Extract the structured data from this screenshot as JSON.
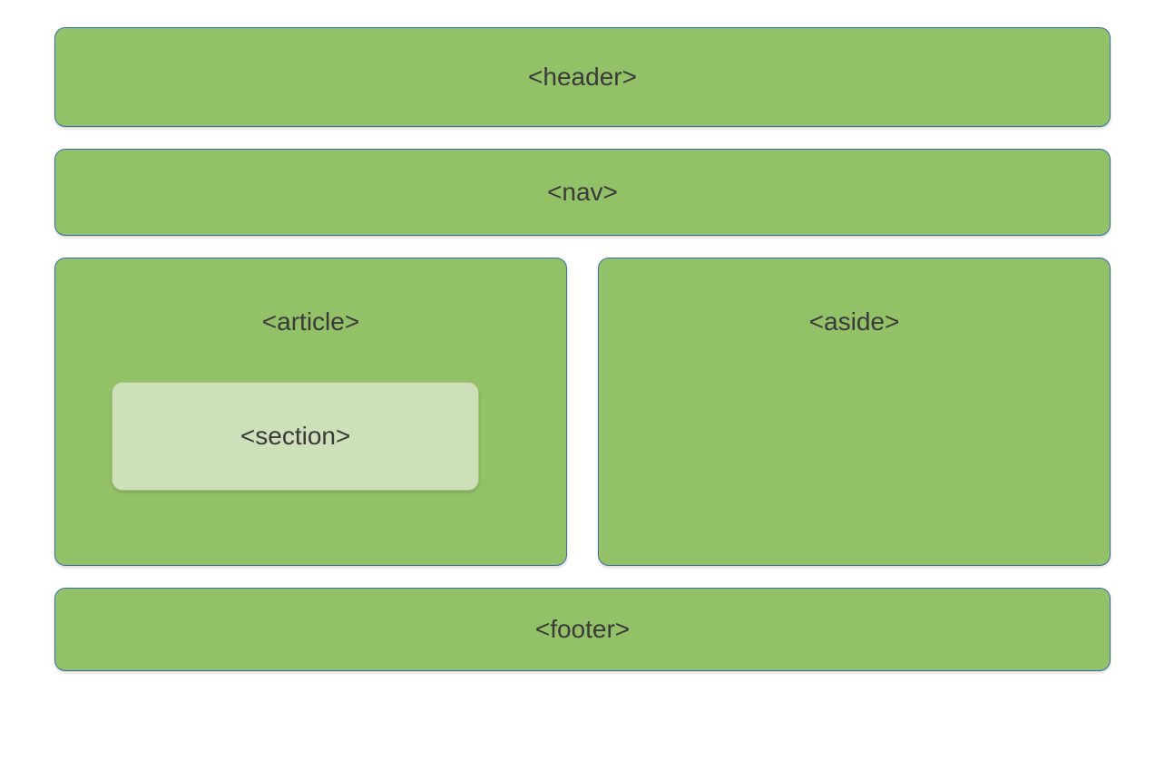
{
  "layout": {
    "header": "<header>",
    "nav": "<nav>",
    "article": "<article>",
    "section": "<section>",
    "aside": "<aside>",
    "footer": "<footer>"
  }
}
